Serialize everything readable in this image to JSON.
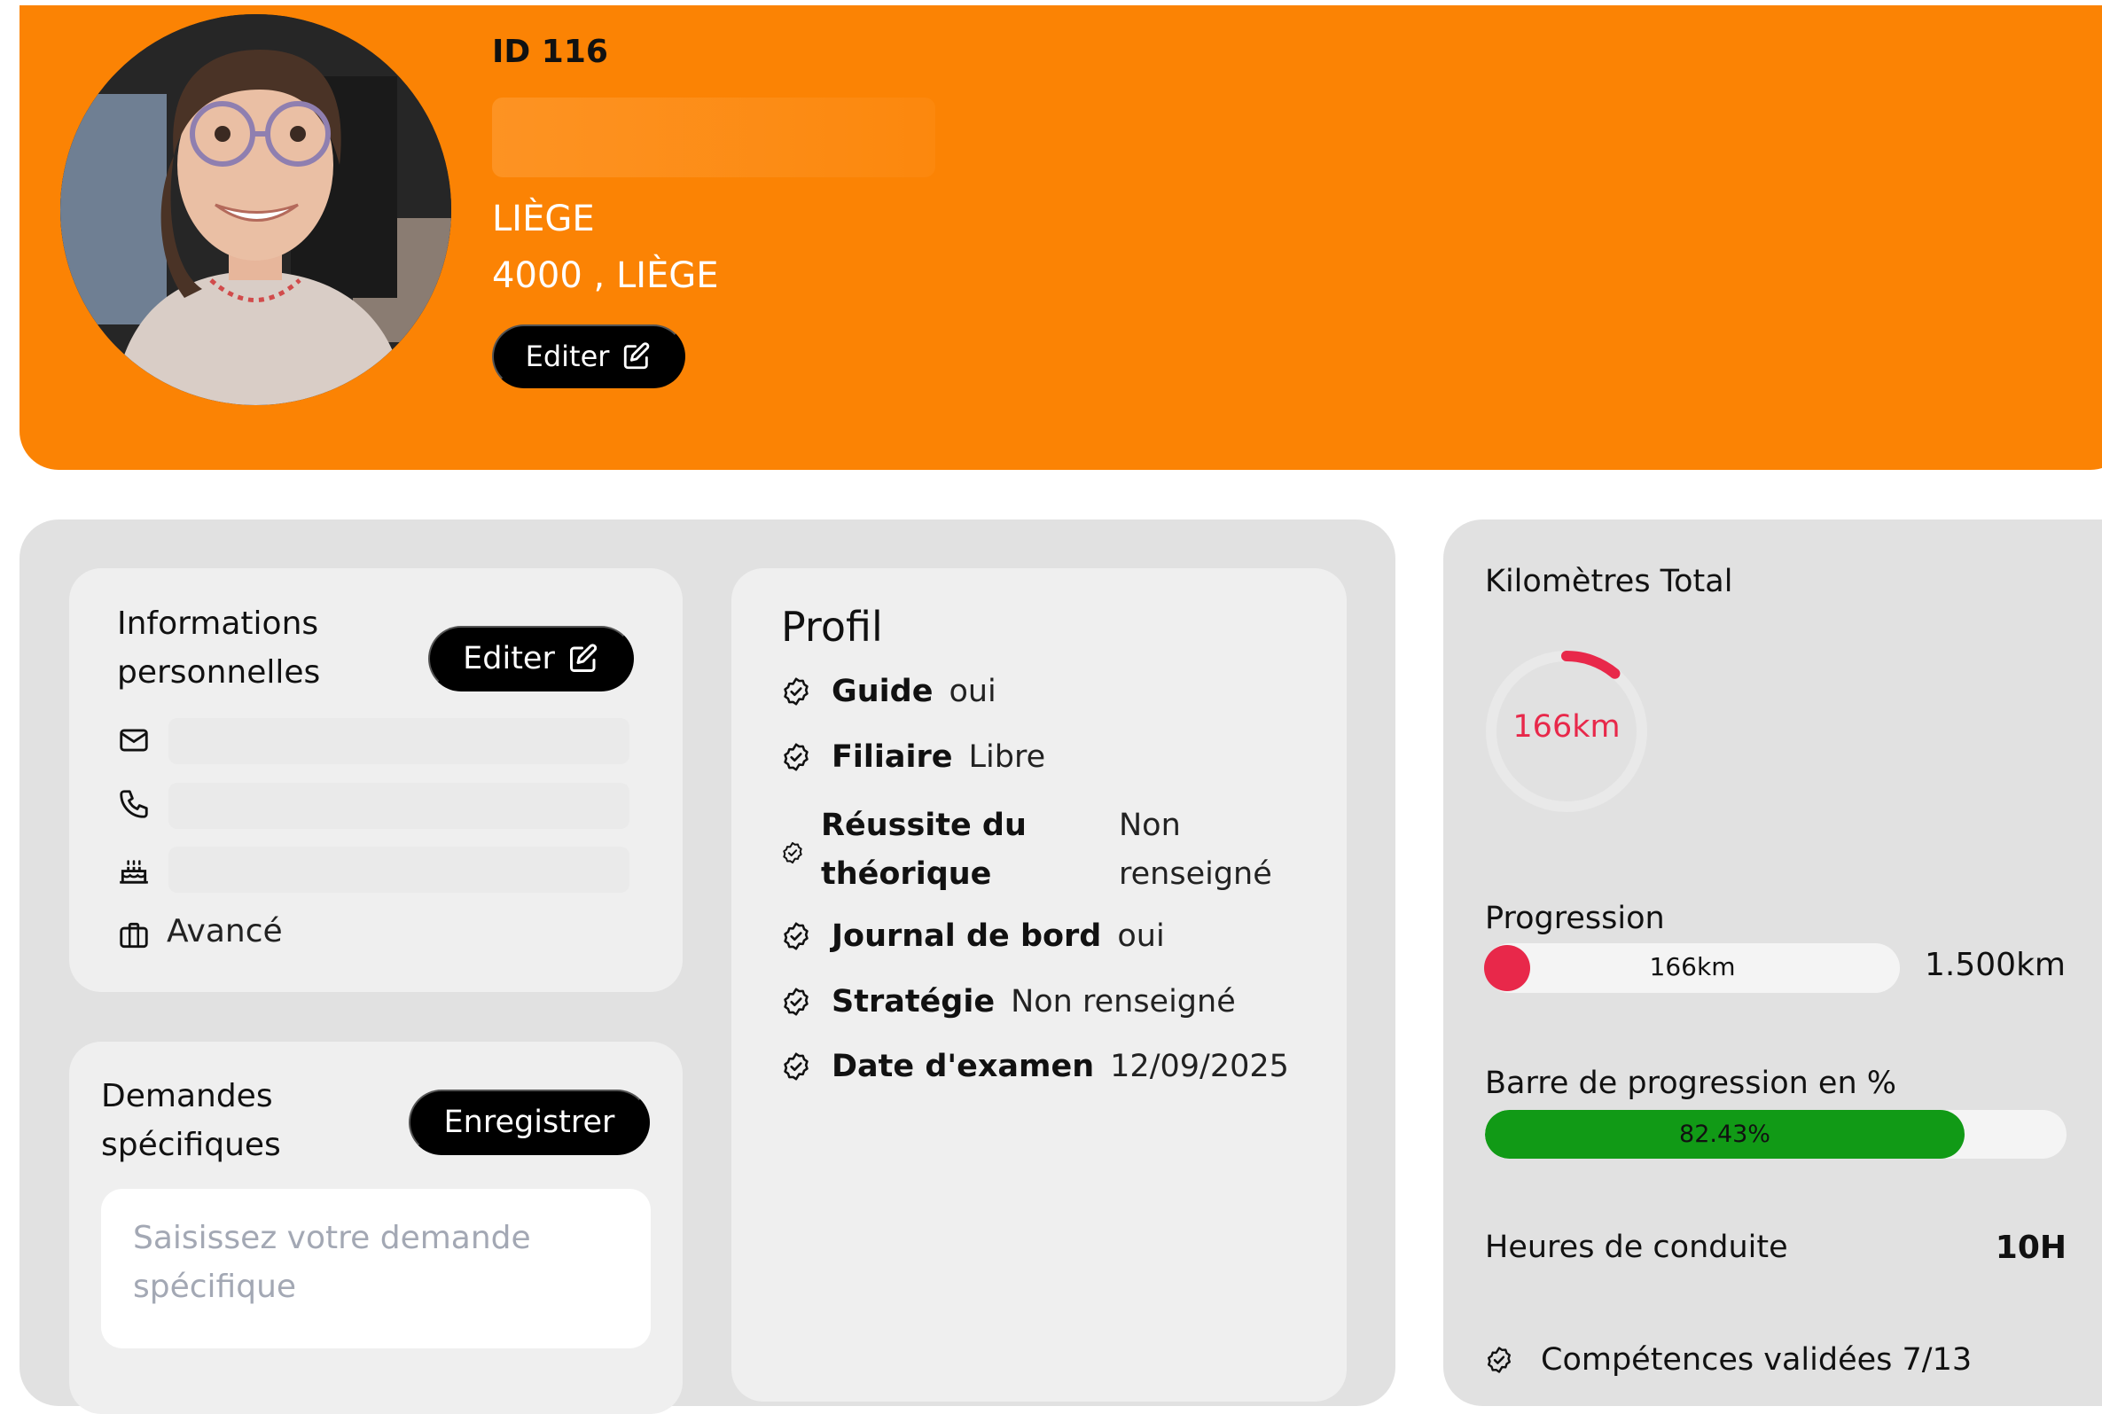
{
  "colors": {
    "banner": "#fb8304",
    "panel": "#e1e1e1",
    "card": "#efefef",
    "accent_red": "#e8284a",
    "progress_green": "#119a16",
    "button": "#000000"
  },
  "header": {
    "id_label": "ID 116",
    "city": "LIÈGE",
    "address": "4000 , LIÈGE",
    "edit_label": "Editer"
  },
  "personal_info": {
    "title": "Informations personnelles",
    "edit_label": "Editer",
    "icons": [
      "mail-icon",
      "phone-icon",
      "cake-icon",
      "briefcase-icon"
    ],
    "level": "Avancé"
  },
  "requests": {
    "title": "Demandes spécifiques",
    "save_label": "Enregistrer",
    "placeholder": "Saisissez votre demande spécifique"
  },
  "profile": {
    "title": "Profil",
    "rows": [
      {
        "label": "Guide",
        "value": "oui"
      },
      {
        "label": "Filiaire",
        "value": "Libre"
      },
      {
        "label": "Réussite du théorique",
        "value": "Non renseigné"
      },
      {
        "label": "Journal de bord",
        "value": "oui"
      },
      {
        "label": "Stratégie",
        "value": "Non renseigné"
      },
      {
        "label": "Date d'examen",
        "value": "12/09/2025"
      }
    ]
  },
  "stats": {
    "km_total_title": "Kilomètres Total",
    "km_total_value": "166km",
    "km_total_ratio": 0.1107,
    "progression_title": "Progression",
    "progression_value": "166km",
    "progression_max": "1.500km",
    "percent_title": "Barre de progression en %",
    "percent_value": 82.43,
    "percent_label": "82.43%",
    "hours_title": "Heures de conduite",
    "hours_value": "10H",
    "skills_label": "Compétences validées 7/13"
  }
}
